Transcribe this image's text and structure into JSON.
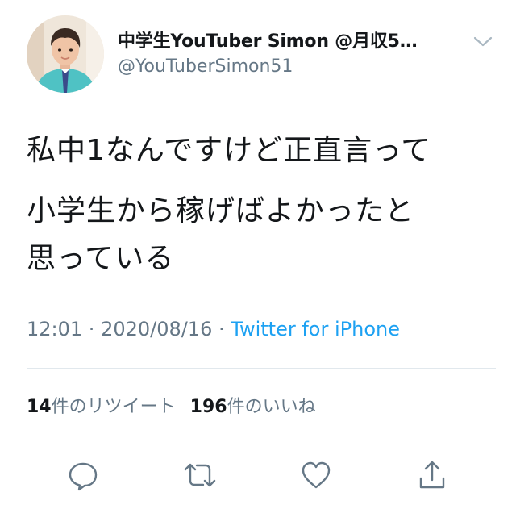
{
  "author": {
    "display_name": "中学生YouTuber Simon @月収5…",
    "handle": "@YouTuberSimon51",
    "avatar_icon": "profile-photo"
  },
  "tweet": {
    "lines": [
      "私中1なんですけど正直言って",
      "小学生から稼げばよかったと",
      "思っている"
    ]
  },
  "meta": {
    "time": "12:01",
    "separator": " · ",
    "date": "2020/08/16",
    "source": "Twitter for iPhone"
  },
  "stats": {
    "retweets_count": "14",
    "retweets_label": "件のリツイート",
    "likes_count": "196",
    "likes_label": "件のいいね"
  },
  "actions": {
    "reply_icon": "reply-icon",
    "retweet_icon": "retweet-icon",
    "like_icon": "heart-icon",
    "share_icon": "share-icon"
  },
  "colors": {
    "text": "#14171a",
    "secondary": "#657786",
    "link": "#1da1f2",
    "divider": "#e1e8ed"
  }
}
